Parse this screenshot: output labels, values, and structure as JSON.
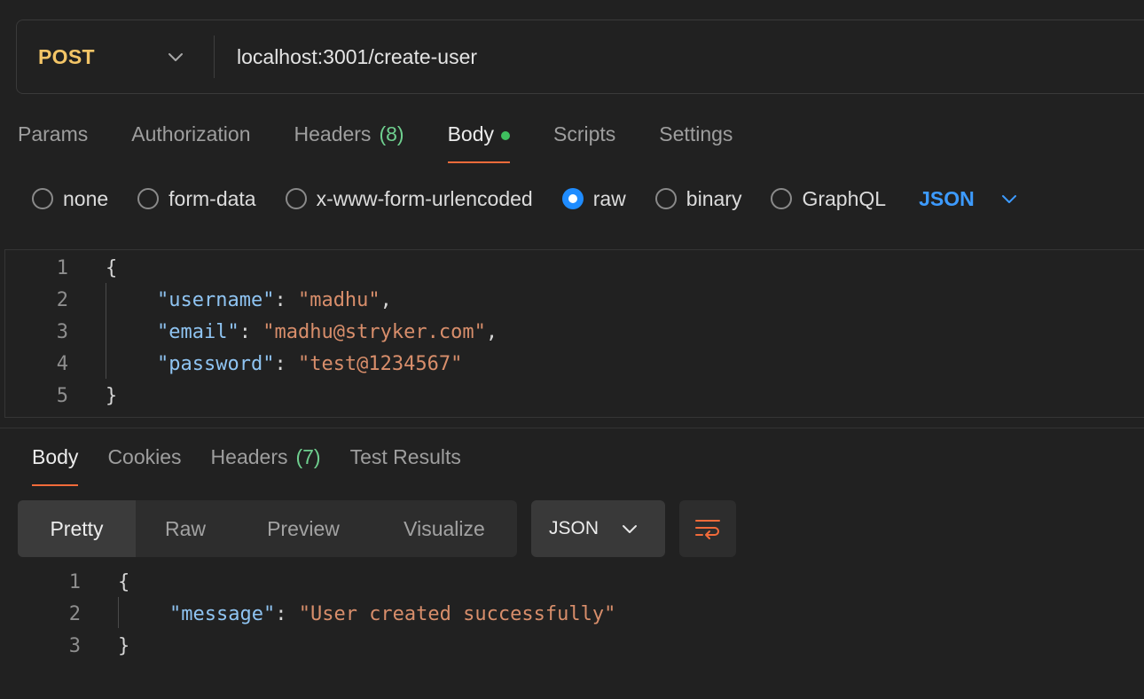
{
  "request": {
    "method": "POST",
    "url": "localhost:3001/create-user",
    "tabs": [
      {
        "label": "Params",
        "count": ""
      },
      {
        "label": "Authorization",
        "count": ""
      },
      {
        "label": "Headers",
        "count": "(8)"
      },
      {
        "label": "Body",
        "count": ""
      },
      {
        "label": "Scripts",
        "count": ""
      },
      {
        "label": "Settings",
        "count": ""
      }
    ],
    "active_tab": "Body",
    "body_types": [
      "none",
      "form-data",
      "x-www-form-urlencoded",
      "raw",
      "binary",
      "GraphQL"
    ],
    "selected_body_type": "raw",
    "format": "JSON",
    "body_lines": [
      {
        "n": "1",
        "text": "{"
      },
      {
        "n": "2",
        "key": "\"username\"",
        "value": "\"madhu\"",
        "trail": ","
      },
      {
        "n": "3",
        "key": "\"email\"",
        "value": "\"madhu@stryker.com\"",
        "trail": ","
      },
      {
        "n": "4",
        "key": "\"password\"",
        "value": "\"test@1234567\"",
        "trail": ""
      },
      {
        "n": "5",
        "text": "}"
      }
    ]
  },
  "response": {
    "tabs": [
      {
        "label": "Body",
        "count": ""
      },
      {
        "label": "Cookies",
        "count": ""
      },
      {
        "label": "Headers",
        "count": "(7)"
      },
      {
        "label": "Test Results",
        "count": ""
      }
    ],
    "active_tab": "Body",
    "view_modes": [
      "Pretty",
      "Raw",
      "Preview",
      "Visualize"
    ],
    "active_view": "Pretty",
    "format": "JSON",
    "body_lines": [
      {
        "n": "1",
        "text": "{"
      },
      {
        "n": "2",
        "key": "\"message\"",
        "value": "\"User created successfully\"",
        "trail": ""
      },
      {
        "n": "3",
        "text": "}"
      }
    ]
  },
  "colors": {
    "method": "#f3c567",
    "accent_tab": "#f26b3a",
    "json_key": "#8fc4f2",
    "json_string": "#d88e6b",
    "link_blue": "#3d9bff",
    "count_green": "#6fcf8f"
  },
  "icons": {
    "method_dropdown": "chevron-down-icon",
    "format_dropdown": "chevron-down-icon",
    "wrap": "text-wrap-icon"
  }
}
